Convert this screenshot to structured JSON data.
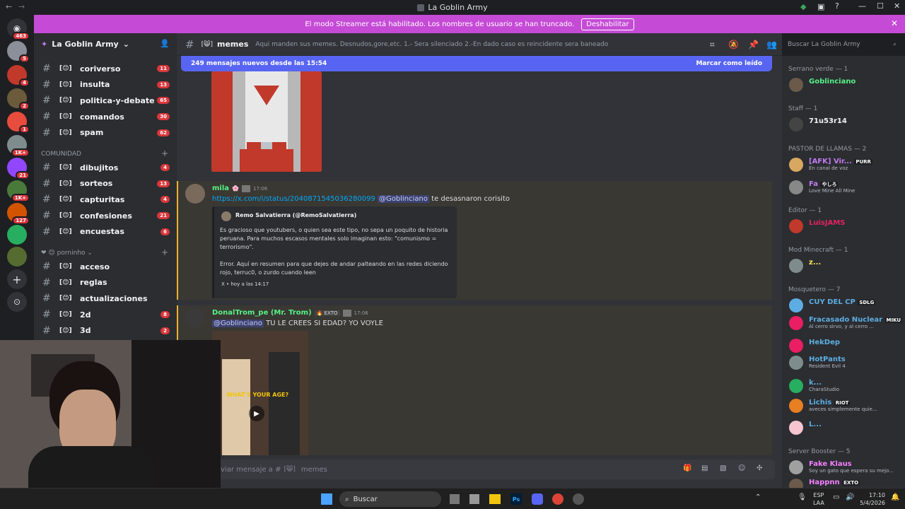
{
  "window_title": "La Goblin Army",
  "streamer_banner": {
    "text": "El modo Streamer está habilitado. Los nombres de usuario se han truncado.",
    "button": "Deshabilitar"
  },
  "server_badges": [
    "463",
    "5",
    "4",
    "2",
    "1",
    "1K+",
    "21",
    "1K+",
    "127"
  ],
  "server_name": "La Goblin Army",
  "channels_top": [
    {
      "name": "coriverso",
      "count": "11"
    },
    {
      "name": "insulta",
      "count": "13"
    },
    {
      "name": "politica-y-debate",
      "count": "65"
    },
    {
      "name": "comandos",
      "count": "30"
    },
    {
      "name": "spam",
      "count": "62"
    }
  ],
  "category_comunidad": "COMUNIDAD",
  "channels_comunidad": [
    {
      "name": "dibujitos",
      "count": "4"
    },
    {
      "name": "sorteos",
      "count": "13"
    },
    {
      "name": "capturitas",
      "count": "4"
    },
    {
      "name": "confesiones",
      "count": "21"
    },
    {
      "name": "encuestas",
      "count": "6"
    }
  ],
  "category_porno": "porninho",
  "channels_porno": [
    {
      "name": "acceso",
      "count": ""
    },
    {
      "name": "reglas",
      "count": ""
    },
    {
      "name": "actualizaciones",
      "count": ""
    },
    {
      "name": "2d",
      "count": "8"
    },
    {
      "name": "3d",
      "count": "2"
    }
  ],
  "channel": {
    "name": "memes",
    "topic": "Aqui manden sus memes. Desnudos,gore,etc. 1.- Sera silenciado 2.-En dado caso es reincidente sera baneado",
    "search_placeholder": "Buscar La Goblin Army"
  },
  "new_messages": {
    "text": "249 mensajes nuevos desde las 15:54",
    "action": "Marcar como leído"
  },
  "messages": [
    {
      "author": "mila",
      "time": "17:06",
      "link": "https://x.com/i/status/2040871545036280099",
      "mention": "@Goblinciano",
      "text": "te desasnaron corisito",
      "embed": {
        "author": "Remo Salvatierra (@RemoSalvatierra)",
        "body1": "Es gracioso que youtubers, o quien sea este tipo, no sepa un poquito de historia peruana. Para muchos escasos mentales solo imaginan esto: \"comunismo = terrorismo\".",
        "body2": "Error. Aquí en resumen para que dejes de andar palteando en las redes diciendo rojo, terruc0, o zurdo cuando leen",
        "footer": "X • hoy a las 14:17"
      }
    },
    {
      "author": "DonalTrom_pe (Mr. Trom)",
      "tag": "EXTO",
      "time": "17:06",
      "mention": "@Goblinciano",
      "text": "TU LE CREES SI EDAD? YO VOYLE",
      "video_caption": "WHAT'S YOUR AGE?"
    }
  ],
  "composer_placeholder": "viar mensaje a #",
  "composer_channel": "memes",
  "members": {
    "groups": [
      {
        "title": "Serrano verde — 1",
        "list": [
          {
            "name": "Goblinciano",
            "status": "",
            "color": "#57f287"
          }
        ]
      },
      {
        "title": "Staff — 1",
        "list": [
          {
            "name": "71u53r14",
            "status": "",
            "color": "#f2f3f5"
          }
        ]
      },
      {
        "title": "PASTOR DE LLAMAS — 2",
        "list": [
          {
            "name": "[AFK] Vir...",
            "tag": "PURR",
            "status": "En canal de voz",
            "color": "#c27cf0"
          },
          {
            "name": "Fa",
            "tag": "やしろ",
            "status": "Love Mine All Mine",
            "color": "#c27cf0"
          }
        ]
      },
      {
        "title": "Editor — 1",
        "list": [
          {
            "name": "LuisJAMS",
            "status": "",
            "color": "#e0245e"
          }
        ]
      },
      {
        "title": "Mod Minecraft — 1",
        "list": [
          {
            "name": "z...",
            "status": "",
            "color": "#fee75c"
          }
        ]
      },
      {
        "title": "Mosquetero — 7",
        "list": [
          {
            "name": "CUY DEL CP",
            "tag": "SDLG",
            "status": "",
            "color": "#5dade2"
          },
          {
            "name": "Fracasado Nuclear",
            "tag": "MIKU",
            "status": "Al cerro sirvo, y al cerro ...",
            "color": "#5dade2"
          },
          {
            "name": "HekDep",
            "status": "",
            "color": "#5dade2"
          },
          {
            "name": "HotPants",
            "status": "Resident Evil 4",
            "color": "#5dade2"
          },
          {
            "name": "k...",
            "status": "CharaStudio",
            "color": "#5dade2"
          },
          {
            "name": "Lichis",
            "tag": "RIOT",
            "status": "aveces simplemente quie...",
            "color": "#5dade2"
          },
          {
            "name": "L...",
            "status": "",
            "color": "#5dade2"
          }
        ]
      },
      {
        "title": "Server Booster — 5",
        "list": [
          {
            "name": "Fake Klaus",
            "status": "Soy un gato que espera su mejo...",
            "color": "#f47fff"
          },
          {
            "name": "Happnn",
            "tag": "EXTO",
            "status": "",
            "color": "#f47fff"
          }
        ]
      }
    ]
  },
  "taskbar": {
    "search": "Buscar",
    "lang1": "ESP",
    "lang2": "LAA",
    "time": "17:10",
    "date": "5/4/2026"
  }
}
